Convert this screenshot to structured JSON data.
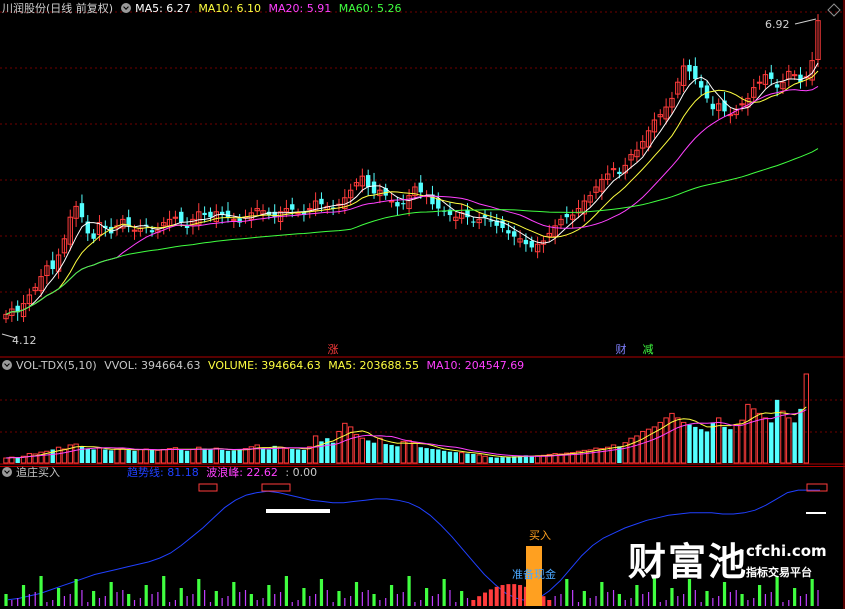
{
  "main_panel": {
    "title": "川润股份(日线 前复权)",
    "ma5_label": "MA5: 6.27",
    "ma10_label": "MA10: 6.10",
    "ma20_label": "MA20: 5.91",
    "ma60_label": "MA60: 5.26",
    "high_marker": "6.92",
    "low_marker": "4.12",
    "event_marks": [
      "涨",
      "财",
      "减"
    ]
  },
  "vol_panel": {
    "title": "VOL-TDX(5,10)",
    "vvol_label": "VVOL: 394664.63",
    "volume_label": "VOLUME: 394664.63",
    "ma5_label": "MA5: 203688.55",
    "ma10_label": "MA10: 204547.69"
  },
  "ind_panel": {
    "title": "追庄买入",
    "trend_label": "趋势线: 81.18",
    "wave_label": "波浪峰: 22.62",
    "extra_label": ": 0.00",
    "buy_label": "买入",
    "ready_label": "准备现金"
  },
  "watermark": {
    "brand": "财富池",
    "domain": "cfchi.com",
    "slogan": "指标交易平台"
  },
  "colors": {
    "up": "#ff3c3c",
    "down": "#54ffff",
    "ma5": "#ffffff",
    "ma10": "#ffff40",
    "ma20": "#ff40ff",
    "ma60": "#40ff40",
    "trend": "#2040ff",
    "grid": "#7a0000"
  },
  "chart_data": [
    {
      "type": "candlestick",
      "ylim": [
        4.0,
        7.0
      ],
      "high": 6.92,
      "low": 4.12,
      "close": [
        4.2,
        4.25,
        4.22,
        4.3,
        4.38,
        4.45,
        4.55,
        4.65,
        4.62,
        4.75,
        4.9,
        5.1,
        5.2,
        5.1,
        4.95,
        4.9,
        5.05,
        5.0,
        4.95,
        5.02,
        5.08,
        5.02,
        4.98,
        5.0,
        5.02,
        4.96,
        4.98,
        5.05,
        5.08,
        5.1,
        5.05,
        5.0,
        5.08,
        5.15,
        5.12,
        5.1,
        5.15,
        5.12,
        5.1,
        5.08,
        5.05,
        5.1,
        5.14,
        5.18,
        5.16,
        5.12,
        5.1,
        5.15,
        5.18,
        5.17,
        5.14,
        5.12,
        5.18,
        5.25,
        5.22,
        5.2,
        5.18,
        5.22,
        5.28,
        5.35,
        5.42,
        5.48,
        5.38,
        5.32,
        5.35,
        5.3,
        5.25,
        5.2,
        5.22,
        5.3,
        5.38,
        5.33,
        5.3,
        5.22,
        5.18,
        5.15,
        5.12,
        5.1,
        5.14,
        5.1,
        5.05,
        5.08,
        5.1,
        5.06,
        5.02,
        5.0,
        4.95,
        4.92,
        4.9,
        4.85,
        4.82,
        4.85,
        4.88,
        4.95,
        5.02,
        5.08,
        5.1,
        5.12,
        5.18,
        5.25,
        5.3,
        5.38,
        5.45,
        5.5,
        5.55,
        5.5,
        5.58,
        5.68,
        5.72,
        5.8,
        5.9,
        6.0,
        6.05,
        6.12,
        6.2,
        6.35,
        6.5,
        6.45,
        6.38,
        6.3,
        6.2,
        6.1,
        6.15,
        6.08,
        6.05,
        6.1,
        6.15,
        6.2,
        6.3,
        6.35,
        6.42,
        6.38,
        6.3,
        6.35,
        6.45,
        6.42,
        6.35,
        6.4,
        6.55,
        6.92
      ],
      "volume": [
        22000,
        26000,
        24000,
        30000,
        42000,
        40000,
        48000,
        52000,
        60000,
        70000,
        62000,
        80000,
        84000,
        72000,
        64000,
        60000,
        66000,
        60000,
        56000,
        62000,
        64000,
        58000,
        54000,
        60000,
        62000,
        58000,
        56000,
        60000,
        64000,
        68000,
        58000,
        54000,
        60000,
        70000,
        64000,
        60000,
        66000,
        58000,
        54000,
        56000,
        60000,
        64000,
        72000,
        80000,
        66000,
        60000,
        76000,
        70000,
        64000,
        62000,
        60000,
        58000,
        72000,
        120000,
        96000,
        110000,
        90000,
        140000,
        176000,
        160000,
        126000,
        110000,
        100000,
        90000,
        110000,
        84000,
        80000,
        74000,
        96000,
        100000,
        90000,
        70000,
        66000,
        62000,
        60000,
        54000,
        50000,
        48000,
        46000,
        42000,
        40000,
        36000,
        30000,
        26000,
        24000,
        26000,
        28000,
        30000,
        32000,
        34000,
        30000,
        32000,
        34000,
        38000,
        42000,
        40000,
        44000,
        46000,
        52000,
        56000,
        58000,
        66000,
        64000,
        70000,
        80000,
        74000,
        90000,
        110000,
        120000,
        140000,
        150000,
        160000,
        180000,
        200000,
        220000,
        200000,
        180000,
        170000,
        160000,
        150000,
        140000,
        180000,
        200000,
        160000,
        150000,
        170000,
        190000,
        260000,
        240000,
        220000,
        200000,
        180000,
        280000,
        230000,
        200000,
        180000,
        240000,
        394664
      ]
    },
    {
      "type": "line",
      "trend_line": [
        0.05,
        0.06,
        0.08,
        0.1,
        0.13,
        0.16,
        0.19,
        0.22,
        0.25,
        0.27,
        0.29,
        0.31,
        0.33,
        0.35,
        0.38,
        0.42,
        0.48,
        0.55,
        0.62,
        0.7,
        0.78,
        0.84,
        0.88,
        0.9,
        0.91,
        0.9,
        0.88,
        0.86,
        0.84,
        0.83,
        0.82,
        0.82,
        0.83,
        0.84,
        0.85,
        0.85,
        0.84,
        0.82,
        0.78,
        0.72,
        0.64,
        0.55,
        0.45,
        0.35,
        0.25,
        0.17,
        0.1,
        0.06,
        0.04,
        0.06,
        0.12,
        0.2,
        0.3,
        0.4,
        0.48,
        0.54,
        0.58,
        0.62,
        0.65,
        0.68,
        0.7,
        0.72,
        0.73,
        0.74,
        0.74,
        0.74,
        0.73,
        0.73,
        0.74,
        0.76,
        0.8,
        0.85,
        0.9,
        0.92,
        0.92,
        0.92
      ],
      "trend_value": 81.18,
      "wave_value": 22.62
    }
  ]
}
